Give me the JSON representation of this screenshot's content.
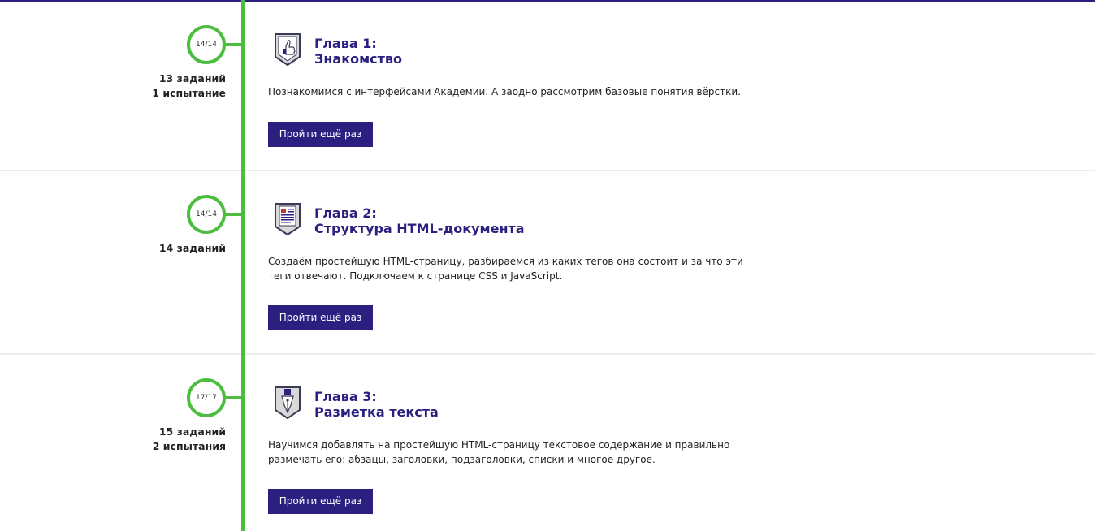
{
  "colors": {
    "accent": "#2b2080",
    "timeline": "#4cbd3f",
    "divider": "#ececec",
    "text": "#222222"
  },
  "chapters": [
    {
      "progress": "14/14",
      "stats": [
        "13 заданий",
        "1 испытание"
      ],
      "title_line1": "Глава 1:",
      "title_line2": "Знакомство",
      "description": "Познакомимся с интерфейсами Академии. А заодно рассмотрим базовые понятия вёрстки.",
      "button_label": "Пройти ещё раз",
      "icon": "thumbs-up-icon"
    },
    {
      "progress": "14/14",
      "stats": [
        "14 заданий"
      ],
      "title_line1": "Глава 2:",
      "title_line2": "Структура HTML-документа",
      "description": "Создаём простейшую HTML-страницу, разбираемся из каких тегов она состоит и за что эти теги отвечают. Подключаем к странице CSS и JavaScript.",
      "button_label": "Пройти ещё раз",
      "icon": "document-icon"
    },
    {
      "progress": "17/17",
      "stats": [
        "15 заданий",
        "2 испытания"
      ],
      "title_line1": "Глава 3:",
      "title_line2": "Разметка текста",
      "description": "Научимся добавлять на простейшую HTML-страницу текстовое содержание и правильно размечать его: абзацы, заголовки, подзаголовки, списки и многое другое.",
      "button_label": "Пройти ещё раз",
      "icon": "pen-nib-icon"
    }
  ]
}
